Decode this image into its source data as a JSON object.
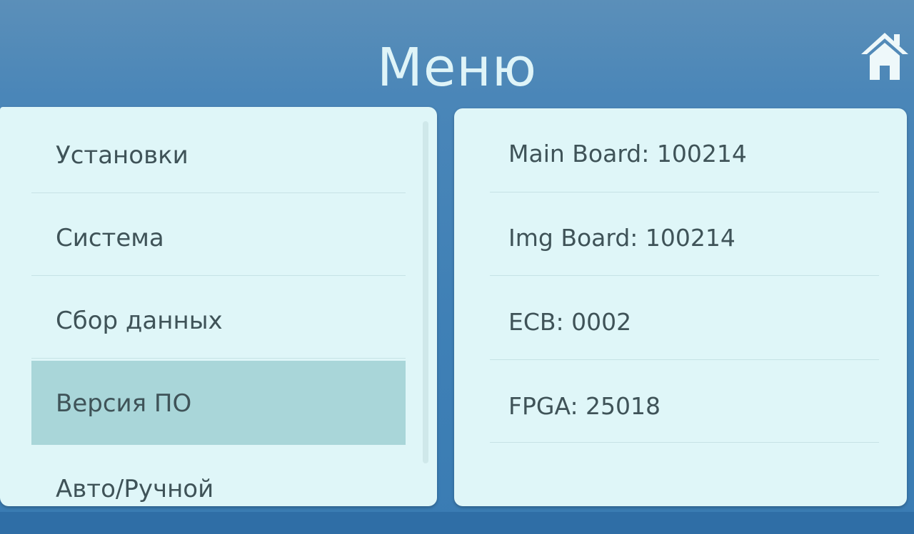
{
  "header": {
    "title": "Меню",
    "home_icon": "home-icon"
  },
  "menu": {
    "items": [
      {
        "label": "Установки"
      },
      {
        "label": "Система"
      },
      {
        "label": "Сбор данных"
      },
      {
        "label": "Версия ПО",
        "selected": true
      },
      {
        "label": "Авто/Ручной"
      }
    ]
  },
  "info": {
    "rows": [
      {
        "text": "Main Board: 100214"
      },
      {
        "text": "Img Board: 100214"
      },
      {
        "text": "ECB: 0002"
      },
      {
        "text": "FPGA: 25018"
      }
    ]
  },
  "colors": {
    "background": "#3f80b6",
    "panel": "#dff6f8",
    "selected": "#a9d6d9",
    "text": "#3f5358",
    "title": "#dff4f8"
  }
}
